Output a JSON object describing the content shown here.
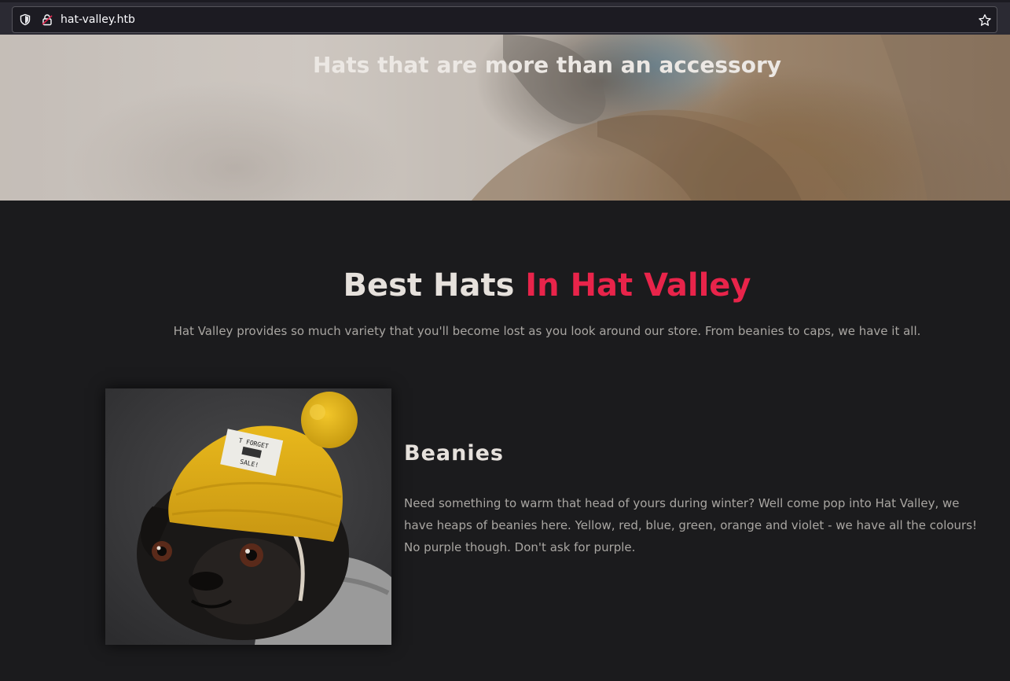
{
  "browser": {
    "url": "hat-valley.htb"
  },
  "hero": {
    "title": "Hats that are more than an accessory"
  },
  "section": {
    "title_main": "Best Hats ",
    "title_accent": "In Hat Valley",
    "subtitle": "Hat Valley provides so much variety that you'll become lost as you look around our store. From beanies to caps, we have it all."
  },
  "product": {
    "title": "Beanies",
    "description": "Need something to warm that head of yours during winter? Well come pop into Hat Valley, we have heaps of beanies here. Yellow, red, blue, green, orange and violet - we have all the colours! No purple though. Don't ask for purple."
  },
  "colors": {
    "accent": "#e8244a",
    "background": "#1b1b1d",
    "heading": "#e6e1dc",
    "body_text": "#a9a6a2"
  }
}
